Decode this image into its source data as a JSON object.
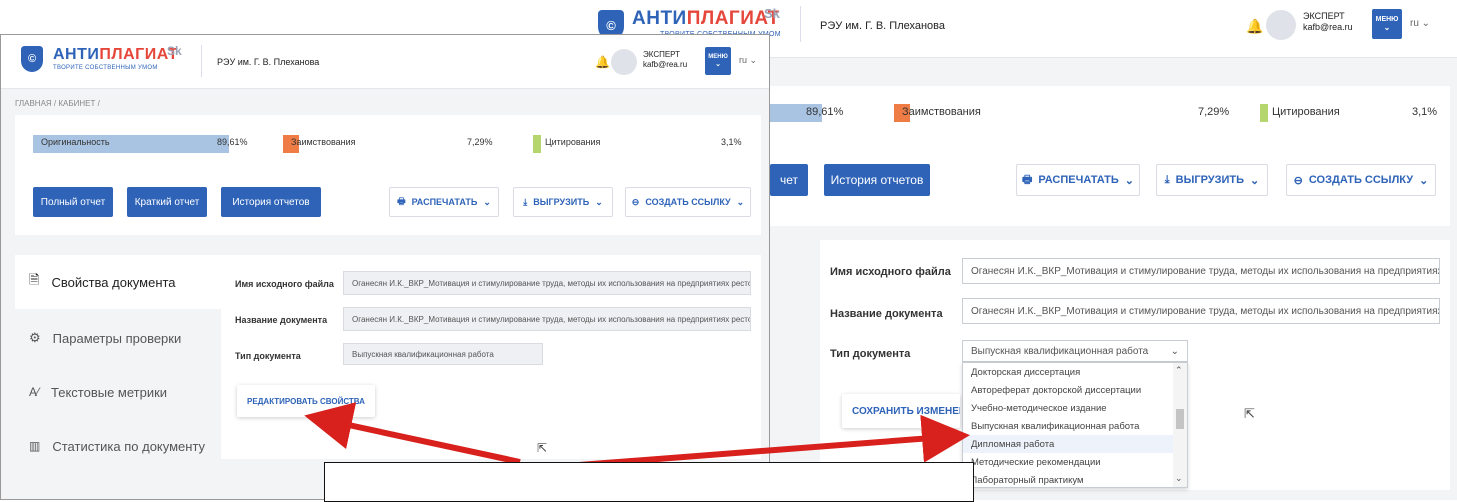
{
  "brand": {
    "logo_main_blue": "АНТИ",
    "logo_main_red": "ПЛАГИАТ",
    "logo_sub": "ТВОРИТЕ СОБСТВЕННЫМ УМОМ",
    "sk": "Sk",
    "accent": "#2e63b8",
    "brand_red": "#e6473b"
  },
  "header": {
    "org": "РЭУ им. Г. В. Плеханова",
    "user_role": "ЭКСПЕРТ",
    "user_email": "kafb@rea.ru",
    "menu_label": "МЕНЮ",
    "lang": "ru"
  },
  "breadcrumb": "ГЛАВНАЯ / КАБИНЕТ /",
  "stats": {
    "originality_label": "Оригинальность",
    "originality_value": "89,61%",
    "borrowing_label": "Заимствования",
    "borrowing_value": "7,29%",
    "citation_label": "Цитирования",
    "citation_value": "3,1%",
    "originality_pct": 89.61,
    "borrowing_pct": 7.29,
    "citation_pct": 3.1,
    "originality_color": "#a9c4e2",
    "borrowing_color": "#f07c45",
    "citation_color": "#b5d66e"
  },
  "report_buttons": {
    "full": "Полный отчет",
    "short": "Краткий отчет",
    "history": "История отчетов",
    "history_right": "История отчетов",
    "full_tail": "чет",
    "print": "РАСПЕЧАТАТЬ",
    "export": "ВЫГРУЗИТЬ",
    "link": "СОЗДАТЬ ССЫЛКУ"
  },
  "sidebar": [
    {
      "label": "Свойства документа",
      "icon": "document-icon"
    },
    {
      "label": "Параметры проверки",
      "icon": "gear-icon"
    },
    {
      "label": "Текстовые метрики",
      "icon": "text-metrics-icon"
    },
    {
      "label": "Статистика по документу",
      "icon": "stats-icon"
    }
  ],
  "properties": {
    "file_name_label": "Имя исходного файла",
    "file_name_value": "Оганесян И.К._ВКР_Мотивация и стимулирование труда, методы их использования на предприятиях ресторанного бизнеса",
    "doc_name_label": "Название документа",
    "doc_name_value": "Оганесян И.К._ВКР_Мотивация и стимулирование труда, методы их использования на предприятиях ресторанного бизнеса",
    "doc_type_label": "Тип документа",
    "doc_type_value": "Выпускная квалификационная работа",
    "edit_button": "РЕДАКТИРОВАТЬ СВОЙСТВА",
    "save_button": "СОХРАНИТЬ ИЗМЕНЕНИЯ"
  },
  "doc_type_options": [
    "Докторская диссертация",
    "Автореферат докторской диссертации",
    "Учебно-методическое издание",
    "Выпускная квалификационная работа",
    "Дипломная работа",
    "Методические рекомендации",
    "Лабораторный практикум"
  ],
  "callout_box_text": ""
}
